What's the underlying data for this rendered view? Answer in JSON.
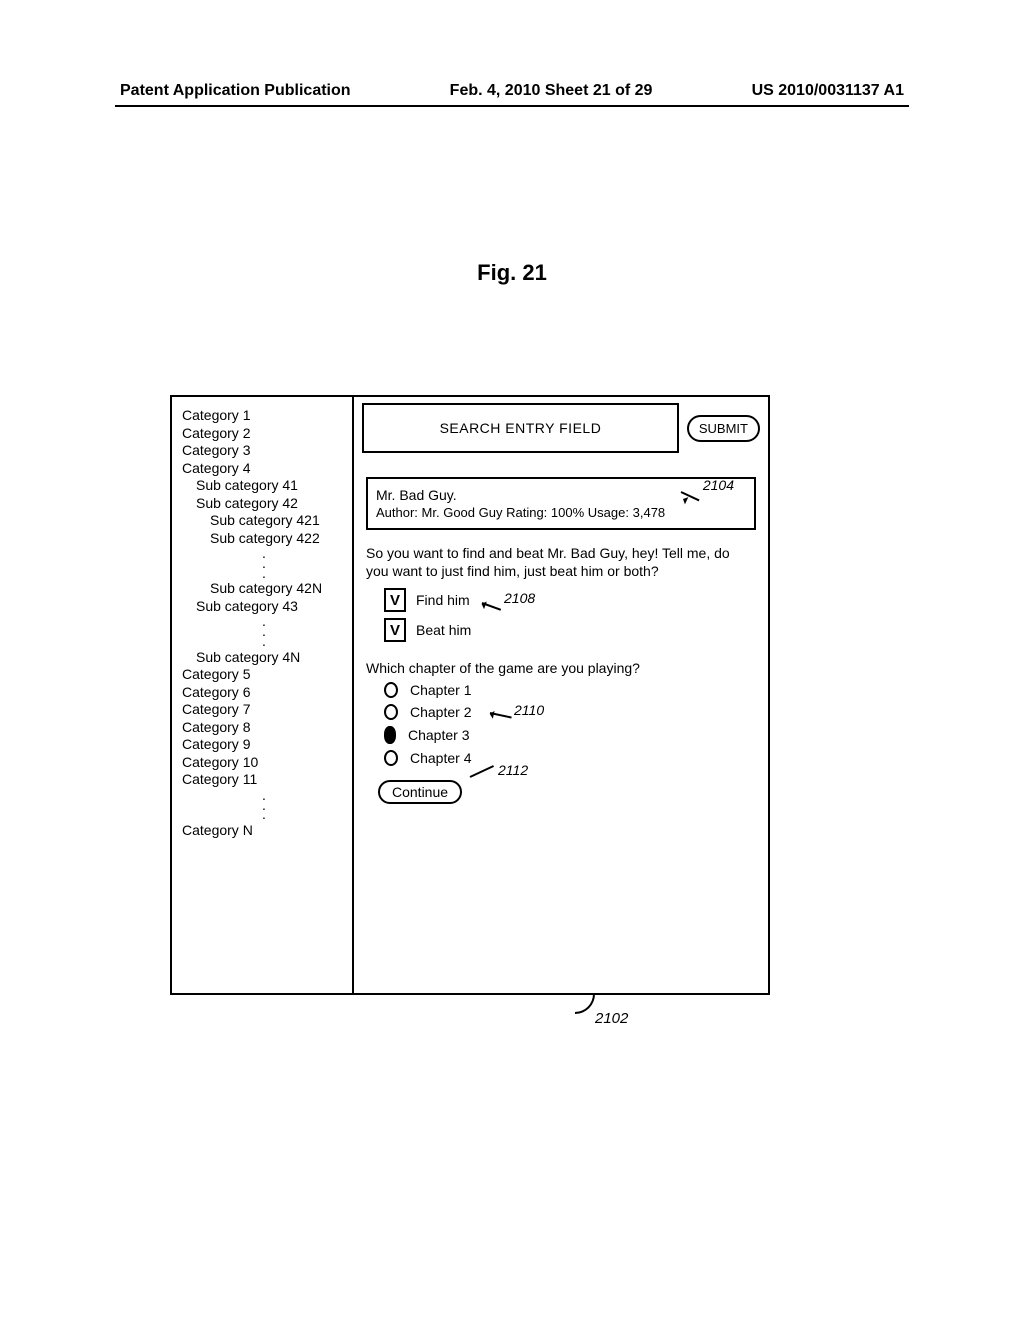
{
  "header": {
    "left": "Patent Application Publication",
    "center": "Feb. 4, 2010  Sheet 21 of 29",
    "right": "US 2010/0031137 A1"
  },
  "figure_title": "Fig. 21",
  "sidebar": {
    "cat1": "Category 1",
    "cat2": "Category 2",
    "cat3": "Category 3",
    "cat4": "Category 4",
    "sub41": "Sub category 41",
    "sub42": "Sub category 42",
    "sub421": "Sub category 421",
    "sub422": "Sub category 422",
    "sub42N": "Sub category 42N",
    "sub43": "Sub category 43",
    "sub4N": "Sub category 4N",
    "cat5": "Category 5",
    "cat6": "Category 6",
    "cat7": "Category 7",
    "cat8": "Category 8",
    "cat9": "Category 9",
    "cat10": "Category 10",
    "cat11": "Category 11",
    "catN": "Category N"
  },
  "search": {
    "placeholder": "SEARCH ENTRY FIELD",
    "submit": "SUBMIT"
  },
  "result": {
    "title": "Mr. Bad Guy.",
    "author_label": "Author:",
    "author": "Mr. Good Guy",
    "rating_label": "Rating:",
    "rating": "100%",
    "usage_label": "Usage:",
    "usage": "3,478"
  },
  "prompt": "So you want to find and beat Mr. Bad Guy, hey! Tell me, do you want to just find him, just beat him or both?",
  "checks": {
    "find": "Find him",
    "beat": "Beat him"
  },
  "question2": "Which chapter of the game are you playing?",
  "chapters": {
    "c1": "Chapter 1",
    "c2": "Chapter 2",
    "c3": "Chapter 3",
    "c4": "Chapter 4"
  },
  "continue_label": "Continue",
  "callouts": {
    "r2104": "2104",
    "r2108": "2108",
    "r2110": "2110",
    "r2112": "2112",
    "r2102": "2102"
  }
}
